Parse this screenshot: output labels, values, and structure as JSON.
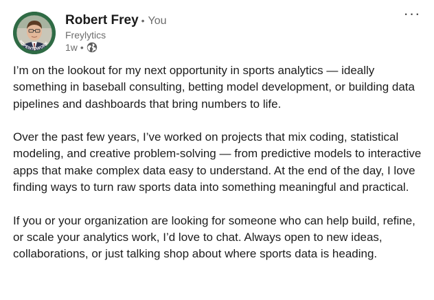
{
  "author": {
    "name": "Robert Frey",
    "you_separator": "•",
    "you_label": "You",
    "headline": "Freylytics",
    "time_ago": "1w",
    "meta_separator": "•",
    "visibility_icon": "globe-icon",
    "avatar_badge_text": "#OPENTOWORK",
    "avatar_badge_color": "#2f6b45"
  },
  "menu": {
    "more_label": "···",
    "more_icon": "ellipsis-icon"
  },
  "post": {
    "paragraphs": [
      "I’m on the lookout for my next opportunity in sports analytics — ideally something in baseball consulting, betting model development, or building data pipelines and dashboards that bring numbers to life.",
      "Over the past few years, I’ve worked on projects that mix coding, statistical modeling, and creative problem-solving — from predictive models to interactive apps that make complex data easy to understand. At the end of the day, I love finding ways to turn raw sports data into something meaningful and practical.",
      "If you or your organization are looking for someone who can help build, refine, or scale your analytics work, I’d love to chat. Always open to new ideas, collaborations, or just talking shop about where sports data is heading."
    ]
  }
}
